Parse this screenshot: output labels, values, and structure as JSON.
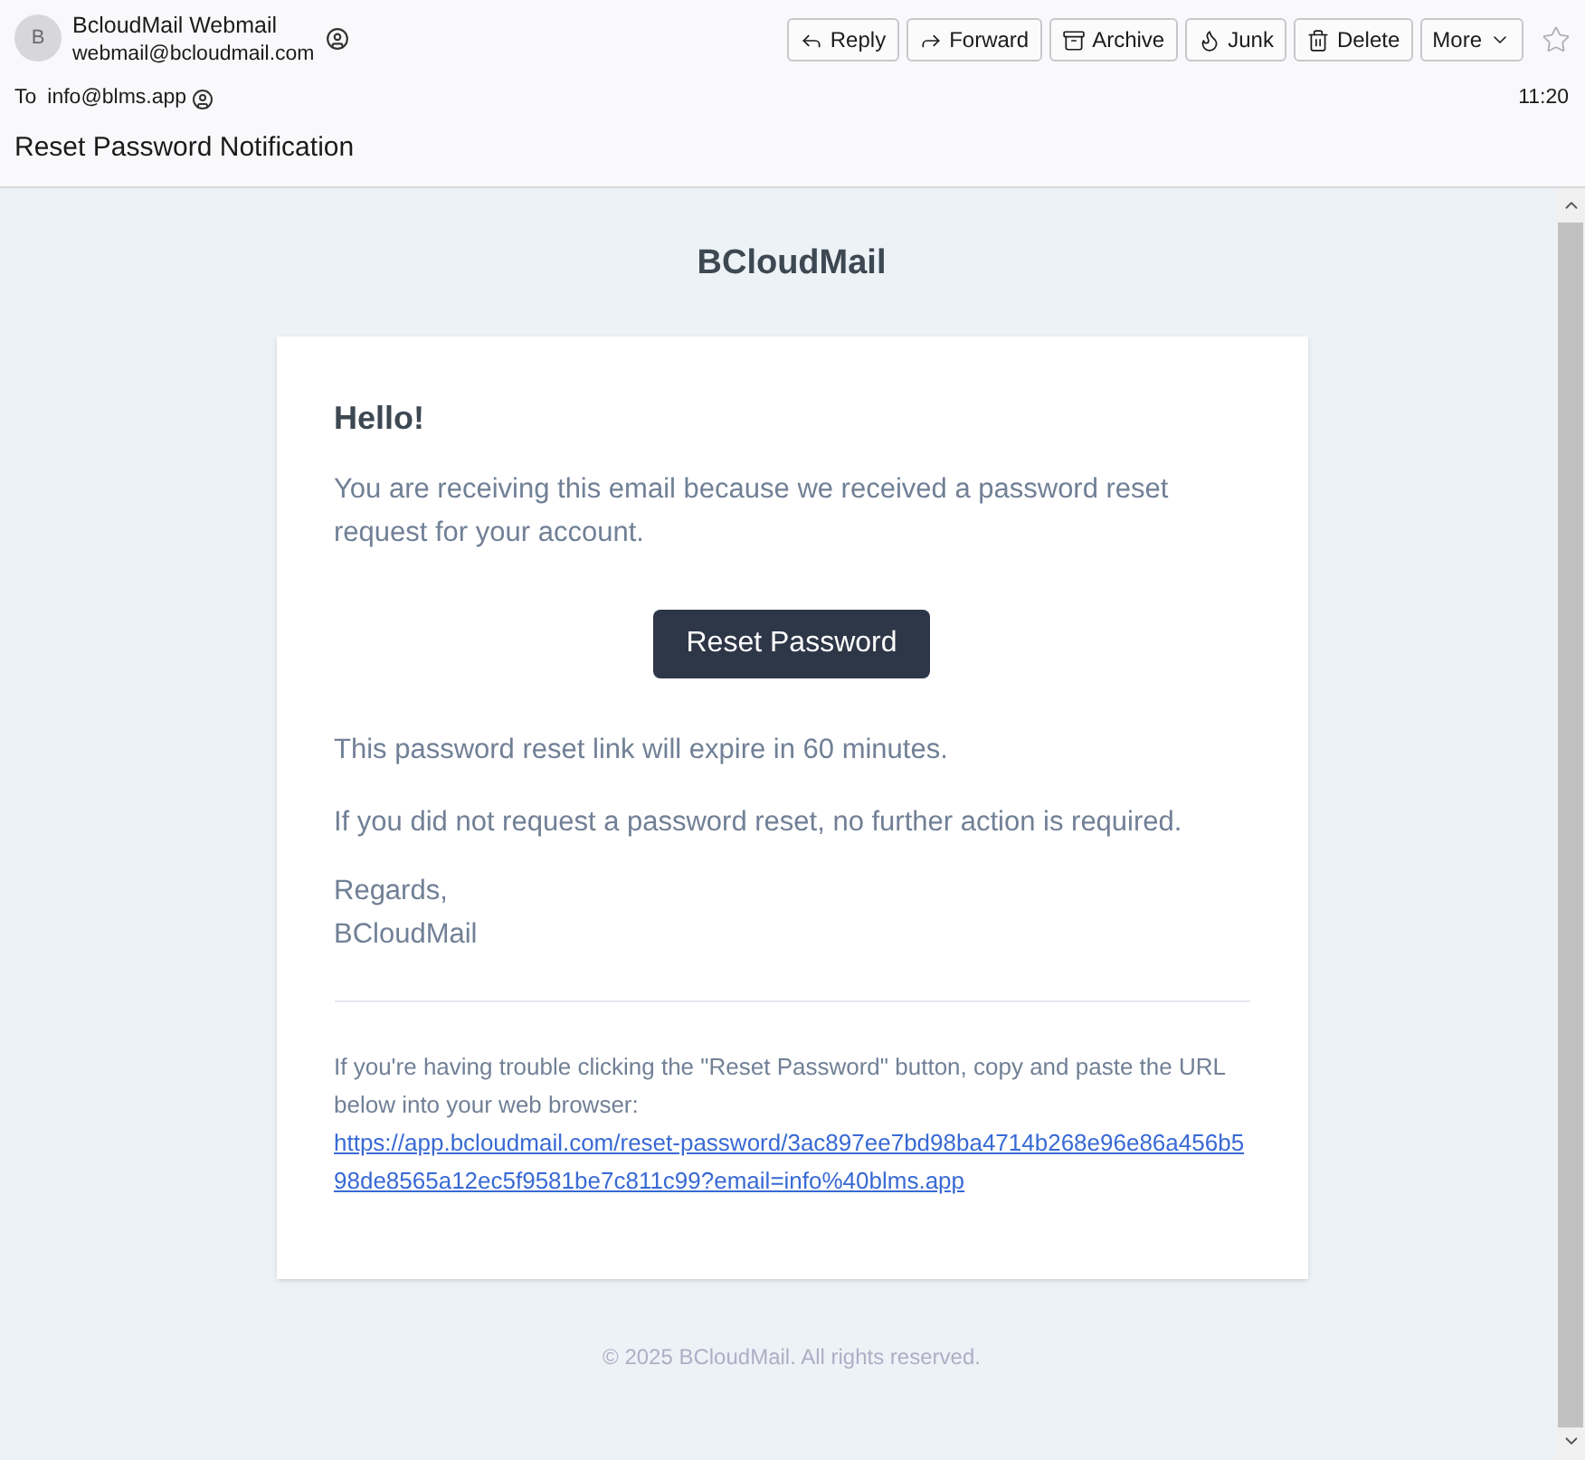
{
  "sender": {
    "avatar": "B",
    "name": "BcloudMail Webmail",
    "email": "webmail@bcloudmail.com"
  },
  "toolbar": [
    {
      "kind": "reply",
      "label": "Reply"
    },
    {
      "kind": "forward",
      "label": "Forward"
    },
    {
      "kind": "archive",
      "label": "Archive"
    },
    {
      "kind": "junk",
      "label": "Junk"
    },
    {
      "kind": "delete",
      "label": "Delete"
    },
    {
      "kind": "more",
      "label": "More"
    }
  ],
  "starred": false,
  "recipient": {
    "label": "To",
    "address": "info@blms.app"
  },
  "time": "11:20",
  "subject": "Reset Password Notification",
  "email": {
    "brand": "BCloudMail",
    "greeting": "Hello!",
    "intro": "You are receiving this email because we received a password reset request for your account.",
    "button": "Reset Password",
    "lines": [
      "This password reset link will expire in 60 minutes.",
      "If you did not request a password reset, no further action is required."
    ],
    "regards": "Regards,",
    "signature": "BCloudMail",
    "trouble": "If you're having trouble clicking the \"Reset Password\" button, copy and paste the URL below into your web browser:",
    "url": "https://app.bcloudmail.com/reset-password/3ac897ee7bd98ba4714b268e96e86a456b598de8565a12ec5f9581be7c811c99?email=info%40blms.app",
    "footer": "© 2025 BCloudMail. All rights reserved."
  }
}
